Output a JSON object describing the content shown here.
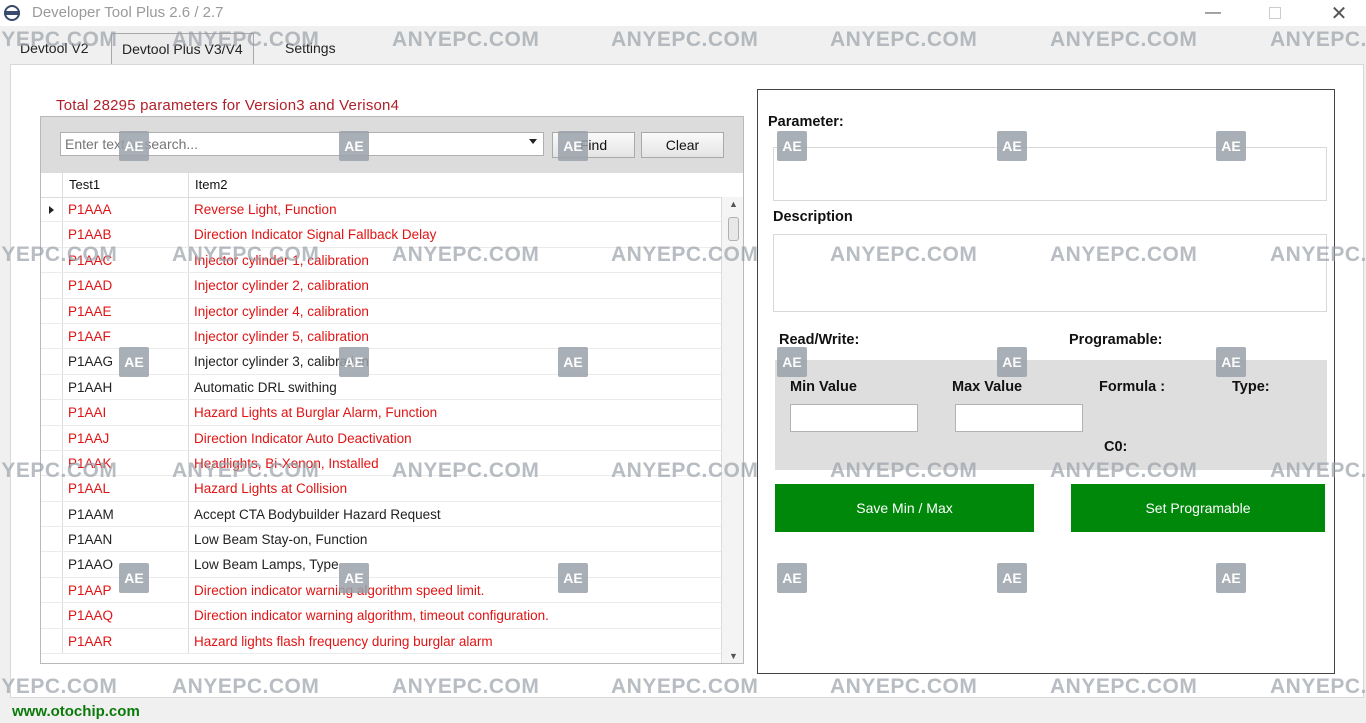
{
  "window": {
    "title": "Developer Tool Plus 2.6 / 2.7"
  },
  "tabs": [
    {
      "label": "Devtool V2"
    },
    {
      "label": "Devtool Plus V3/V4"
    },
    {
      "label": "Settings"
    }
  ],
  "summary": {
    "text": "Total 28295 parameters for Version3 and Verison4"
  },
  "search": {
    "placeholder": "Enter text to search...",
    "find_label": "Find",
    "clear_label": "Clear"
  },
  "table": {
    "columns": [
      "Test1",
      "Item2"
    ],
    "rows": [
      {
        "code": "P1AAA",
        "item": "Reverse Light, Function",
        "color": "#e01414"
      },
      {
        "code": "P1AAB",
        "item": "Direction Indicator Signal Fallback Delay",
        "color": "#e01414"
      },
      {
        "code": "P1AAC",
        "item": "Injector cylinder 1, calibration",
        "color": "#e01414"
      },
      {
        "code": "P1AAD",
        "item": "Injector cylinder 2, calibration",
        "color": "#e01414"
      },
      {
        "code": "P1AAE",
        "item": "Injector cylinder 4, calibration",
        "color": "#e01414"
      },
      {
        "code": "P1AAF",
        "item": "Injector cylinder 5, calibration",
        "color": "#e01414"
      },
      {
        "code": "P1AAG",
        "item": "Injector cylinder 3, calibration",
        "color": "#222222"
      },
      {
        "code": "P1AAH",
        "item": "Automatic DRL swithing",
        "color": "#222222"
      },
      {
        "code": "P1AAI",
        "item": "Hazard Lights at Burglar Alarm, Function",
        "color": "#e01414"
      },
      {
        "code": "P1AAJ",
        "item": "Direction Indicator Auto Deactivation",
        "color": "#e01414"
      },
      {
        "code": "P1AAK",
        "item": "Headlights, Bi-Xenon, Installed",
        "color": "#e01414"
      },
      {
        "code": "P1AAL",
        "item": "Hazard Lights at Collision",
        "color": "#e01414"
      },
      {
        "code": "P1AAM",
        "item": "Accept CTA Bodybuilder Hazard Request",
        "color": "#222222"
      },
      {
        "code": "P1AAN",
        "item": "Low Beam Stay-on, Function",
        "color": "#222222"
      },
      {
        "code": "P1AAO",
        "item": "Low Beam Lamps, Type",
        "color": "#222222"
      },
      {
        "code": "P1AAP",
        "item": "Direction indicator warning algorithm speed limit.",
        "color": "#e01414"
      },
      {
        "code": "P1AAQ",
        "item": "Direction indicator warning algorithm, timeout configuration.",
        "color": "#e01414"
      },
      {
        "code": "P1AAR",
        "item": "Hazard lights flash frequency during burglar alarm",
        "color": "#e01414"
      }
    ]
  },
  "detail": {
    "parameter_label": "Parameter:",
    "description_label": "Description",
    "readwrite_label": "Read/Write:",
    "programable_label": "Programable:",
    "min_label": "Min Value",
    "max_label": "Max Value",
    "formula_label": "Formula :",
    "type_label": "Type:",
    "c0_label": "C0:",
    "save_label": "Save Min / Max",
    "set_label": "Set Programable"
  },
  "footer": {
    "text": "www.otochip.com"
  },
  "watermark": {
    "text": "ANYEPC.COM",
    "badge": "AE"
  },
  "colors": {
    "accent_green": "#00880a",
    "summary_red": "#b0202a",
    "row_red": "#e01414"
  }
}
